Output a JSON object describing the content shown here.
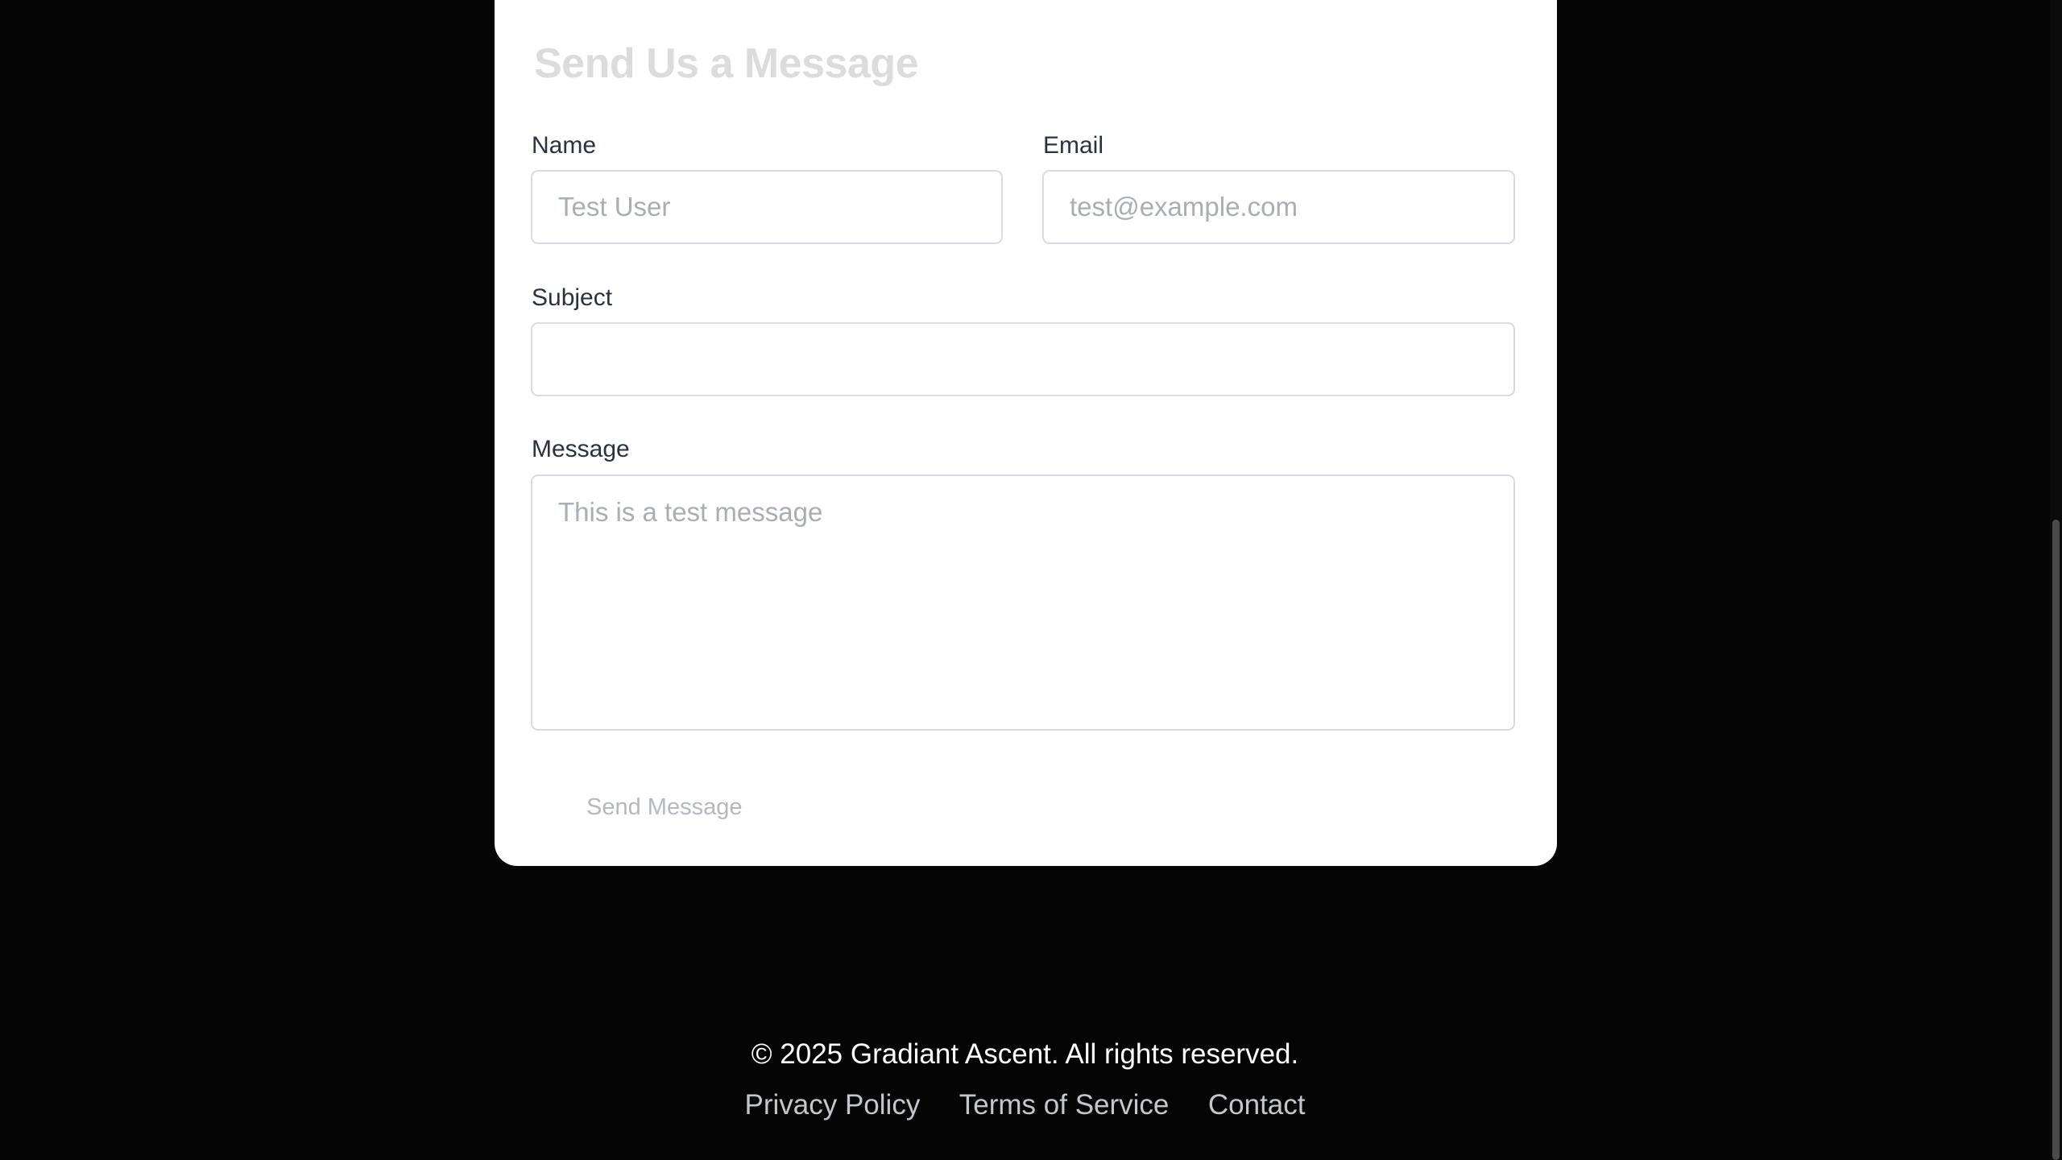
{
  "form": {
    "title": "Send Us a Message",
    "name": {
      "label": "Name",
      "placeholder": "Test User"
    },
    "email": {
      "label": "Email",
      "placeholder": "test@example.com"
    },
    "subject": {
      "label": "Subject",
      "placeholder": ""
    },
    "message": {
      "label": "Message",
      "placeholder": "This is a test message"
    },
    "submit_label": "Send Message"
  },
  "footer": {
    "copyright": "© 2025 Gradiant Ascent. All rights reserved.",
    "links": [
      {
        "label": "Privacy Policy"
      },
      {
        "label": "Terms of Service"
      },
      {
        "label": "Contact"
      }
    ]
  },
  "colors": {
    "page_background": "#050505",
    "card_background": "#ffffff",
    "label_text": "#2a3242",
    "placeholder_text": "#a9aeb6"
  }
}
